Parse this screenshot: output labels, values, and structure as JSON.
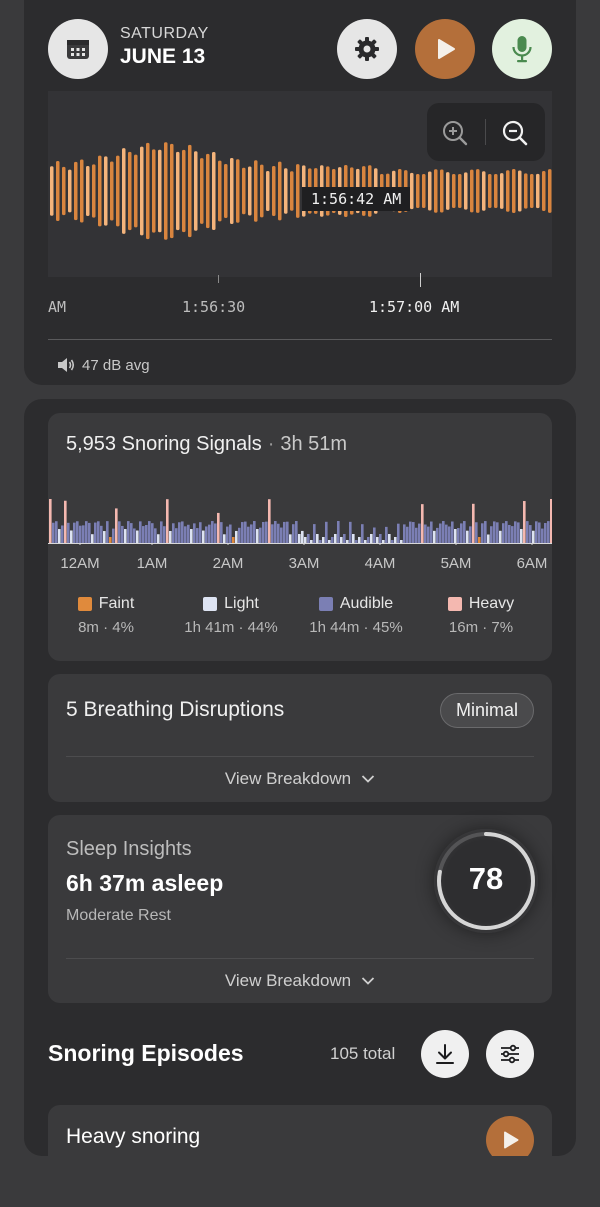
{
  "header": {
    "day": "SATURDAY",
    "date": "JUNE 13",
    "colors": {
      "play": "#b46f3a",
      "mic": "#e2f1df",
      "mic_icon": "#4a8a4f",
      "settings": "#e6e6e6",
      "calendar": "#e6e6e6"
    }
  },
  "waveform": {
    "cursor_time": "1:56:42 AM",
    "axis_labels": [
      "AM",
      "1:56:30",
      "1:57:00 AM"
    ],
    "avg_db": "47 dB avg"
  },
  "signals": {
    "count": "5,953 Snoring Signals",
    "duration": "3h 51m",
    "hours": [
      "12AM",
      "1AM",
      "2AM",
      "3AM",
      "4AM",
      "5AM",
      "6AM"
    ],
    "legend": [
      {
        "name": "Faint",
        "value": "8m · 4%",
        "color": "#e08a3c"
      },
      {
        "name": "Light",
        "value": "1h 41m · 44%",
        "color": "#dde3f2"
      },
      {
        "name": "Audible",
        "value": "1h 44m · 45%",
        "color": "#7b7fb4"
      },
      {
        "name": "Heavy",
        "value": "16m · 7%",
        "color": "#f4b8b0"
      }
    ]
  },
  "disruptions": {
    "title": "5 Breathing Disruptions",
    "badge": "Minimal",
    "view": "View Breakdown"
  },
  "insights": {
    "label": "Sleep Insights",
    "asleep": "6h 37m asleep",
    "rest": "Moderate Rest",
    "score": "78",
    "score_fraction": 0.78,
    "view": "View Breakdown"
  },
  "episodes": {
    "title": "Snoring Episodes",
    "total": "105 total",
    "first": "Heavy snoring"
  }
}
